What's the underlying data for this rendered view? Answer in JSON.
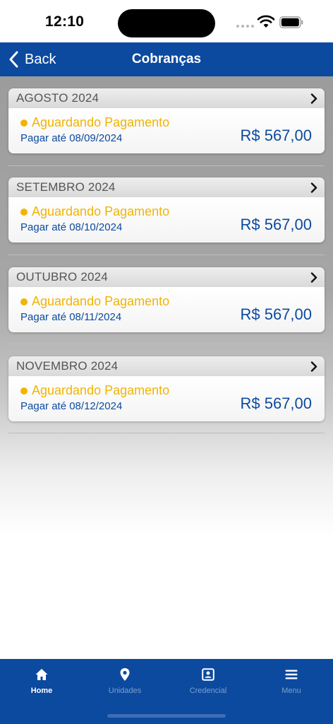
{
  "status_bar": {
    "time": "12:10"
  },
  "nav": {
    "back_label": "Back",
    "title": "Cobranças"
  },
  "charges": [
    {
      "month": "AGOSTO 2024",
      "status": "Aguardando Pagamento",
      "due": "Pagar até 08/09/2024",
      "amount": "R$ 567,00"
    },
    {
      "month": "SETEMBRO 2024",
      "status": "Aguardando Pagamento",
      "due": "Pagar até 08/10/2024",
      "amount": "R$ 567,00"
    },
    {
      "month": "OUTUBRO 2024",
      "status": "Aguardando Pagamento",
      "due": "Pagar até 08/11/2024",
      "amount": "R$ 567,00"
    },
    {
      "month": "NOVEMBRO 2024",
      "status": "Aguardando Pagamento",
      "due": "Pagar até 08/12/2024",
      "amount": "R$ 567,00"
    }
  ],
  "tabs": [
    {
      "label": "Home",
      "icon": "home-icon",
      "active": true
    },
    {
      "label": "Unidades",
      "icon": "location-pin-icon",
      "active": false
    },
    {
      "label": "Credencial",
      "icon": "id-badge-icon",
      "active": false
    },
    {
      "label": "Menu",
      "icon": "menu-icon",
      "active": false
    }
  ],
  "colors": {
    "brand_blue": "#0b4a9e",
    "status_pending": "#f2b400",
    "amount_text": "#0b4a9e"
  }
}
